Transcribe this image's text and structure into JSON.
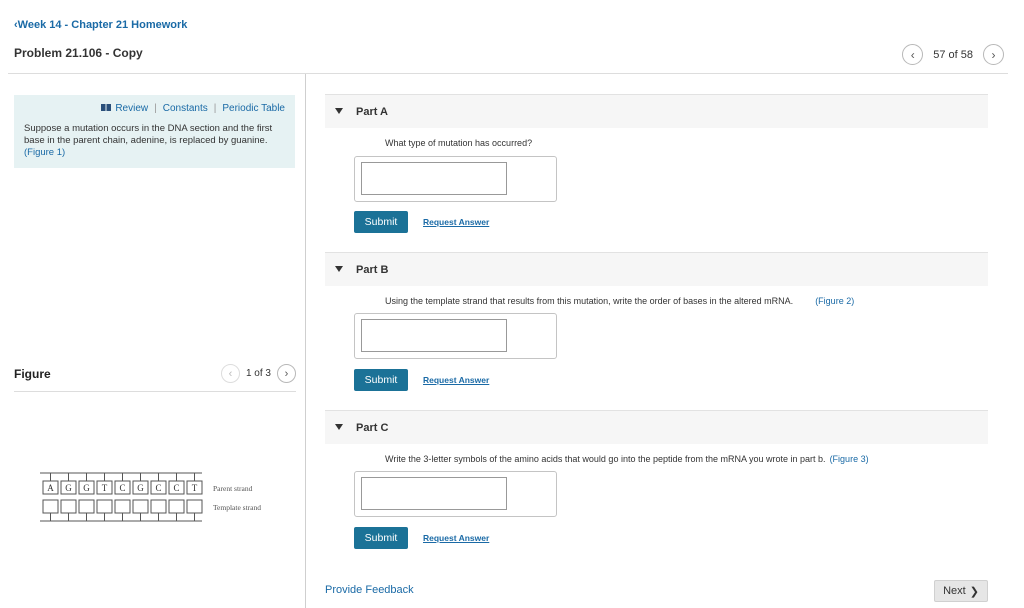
{
  "header": {
    "back_label": "Week 14 - Chapter 21 Homework",
    "back_chevron": "‹",
    "problem_title": "Problem 21.106 - Copy",
    "pager": {
      "prev": "‹",
      "next": "›",
      "text": "57 of 58"
    }
  },
  "intro": {
    "tools": [
      "Review",
      "Constants",
      "Periodic Table"
    ],
    "tools_separator": "|",
    "text": "Suppose a mutation occurs in the DNA section and the first base in the parent chain, adenine, is replaced by guanine.",
    "figure_link": "(Figure 1)"
  },
  "figure": {
    "label": "Figure",
    "pager": {
      "prev": "‹",
      "next": "›",
      "text": "1 of 3"
    },
    "bases": [
      "A",
      "G",
      "G",
      "T",
      "C",
      "G",
      "C",
      "C",
      "T"
    ],
    "parent_label": "Parent strand",
    "template_label": "Template strand"
  },
  "parts": [
    {
      "title": "Part A",
      "question": "What type of mutation has occurred?",
      "figure_link": "",
      "submit": "Submit",
      "request": "Request Answer"
    },
    {
      "title": "Part B",
      "question": "Using the template strand that results from this mutation, write the order of bases in the altered mRNA.",
      "figure_link": "(Figure 2)",
      "submit": "Submit",
      "request": "Request Answer"
    },
    {
      "title": "Part C",
      "question": "Write the 3-letter symbols of the amino acids that would go into the peptide from the mRNA you wrote in part b.",
      "figure_link": "(Figure 3)",
      "submit": "Submit",
      "request": "Request Answer"
    }
  ],
  "footer": {
    "feedback": "Provide Feedback",
    "next": "Next",
    "next_chevron": "❯"
  },
  "colors": {
    "link": "#1a6aa6",
    "submit": "#1b7297",
    "intro_bg": "#e6f2f3"
  },
  "icons": {
    "review": "book-icon"
  }
}
